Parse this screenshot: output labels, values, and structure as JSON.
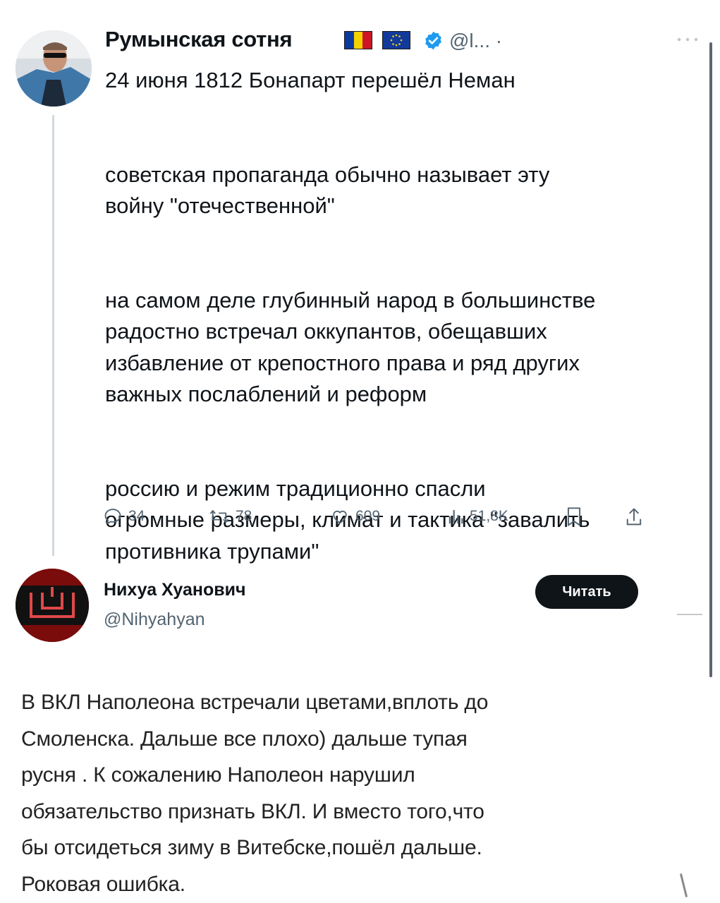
{
  "tweet1": {
    "author_name": "Румынская сотня",
    "handle": "@l...",
    "handle_separator": "·",
    "text": "24 июня 1812 Бонапарт перешёл Неман\n\n\nсоветская пропаганда обычно называет эту\nвойну \"отечественной\"\n\n\nна самом деле глубинный народ в большинстве\nрадостно встречал оккупантов, обещавших\nизбавление от крепостного права и ряд других\nважных послаблений и реформ\n\n\nроссию и режим традиционно спасли\nогромные размеры, климат и тактика \"завалить\nпротивника трупами\"",
    "flags": [
      "romania-flag",
      "eu-flag"
    ],
    "verified_icon": "verified-badge-icon",
    "more_icon": "more-options-icon",
    "actions": {
      "replies": "34",
      "reposts": "78",
      "likes": "609",
      "views": "51,8K"
    },
    "colors": {
      "secondary": "#536471",
      "verified": "#1d9bf0"
    }
  },
  "tweet2": {
    "author_name": "Нихуа Хуанович",
    "handle": "@Nihyahyan",
    "follow_label": "Читать",
    "text": "В ВКЛ Наполеона встречали цветами,вплоть до\nСмоленска. Дальше все плохо) дальше тупая\nрусня . К сожалению Наполеон нарушил\nобязательство признать ВКЛ. И вместо того,что\nбы отсидеться зиму в Витебске,пошёл дальше.\nРоковая ошибка.",
    "colors": {
      "avatar_bg": "#7a0c0c",
      "button_bg": "#0f1419"
    }
  }
}
